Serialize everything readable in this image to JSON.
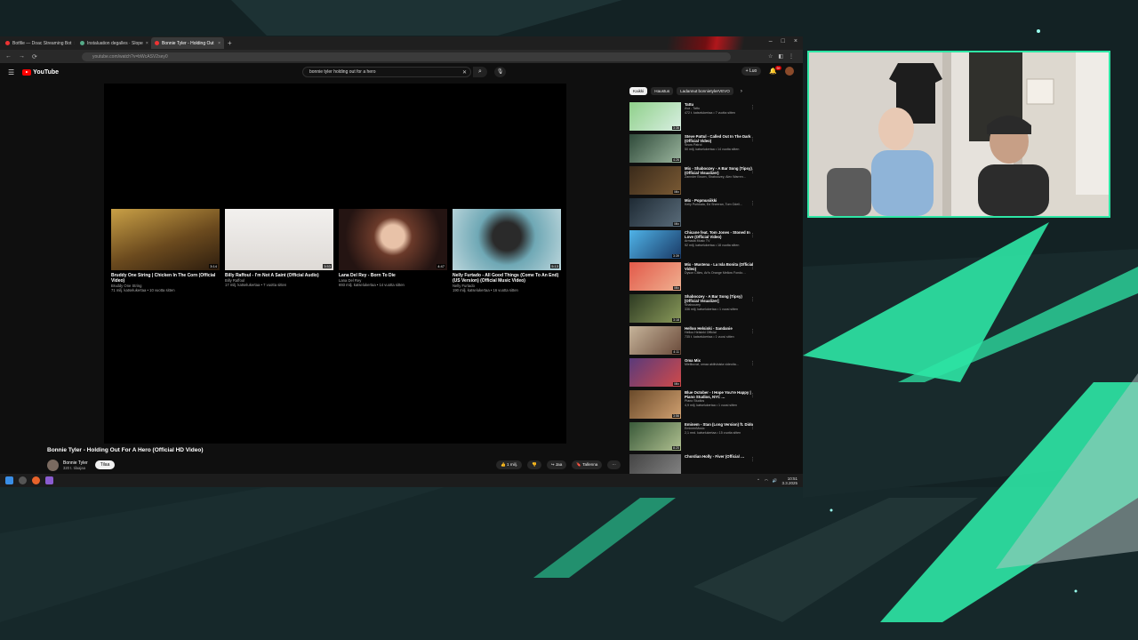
{
  "colors": {
    "accent_green": "#2ee6a5",
    "youtube_red": "#ff0000",
    "background": "#0f1a1c"
  },
  "browser": {
    "tabs": [
      {
        "label": "Botfile — Doac Streaming Bot",
        "active": false
      },
      {
        "label": "Instaluation degalles · Slope",
        "active": false
      },
      {
        "label": "Bonnie Tyler - Holding Out",
        "active": true
      }
    ],
    "url": "youtube.com/watch?v=bWcASV2sey0"
  },
  "youtube": {
    "logo_text": "YouTube",
    "search_value": "bonnie tyler holding out for a hero",
    "create_label": "Luo",
    "notification_count": "9+",
    "video_title": "Bonnie Tyler - Holding Out For A Hero (Official HD Video)",
    "channel_name": "Bonnie Tyler",
    "channel_subs": "320 t. tilaajaa",
    "subscribe_label": "Tilaa",
    "like_count": "1 milj.",
    "share_label": "Jaa",
    "save_label": "Tallenna",
    "endscreen": [
      {
        "title": "Bruddy One String | Chicken In The Corn (Official Video)",
        "channel": "Bruddy One String",
        "meta": "71 milj. katselukertaa • 10 vuotta sitten",
        "duration": "3:14"
      },
      {
        "title": "Billy Raffoul - I'm Not A Saint (Official Audio)",
        "channel": "Billy Raffoul",
        "meta": "17 milj. katselukertaa • 7 vuotta sitten",
        "duration": "3:53"
      },
      {
        "title": "Lana Del Rey - Born To Die",
        "channel": "Lana Del Rey",
        "meta": "693 milj. katselukertaa • 14 vuotta sitten",
        "duration": "4:47"
      },
      {
        "title": "Nelly Furtado - All Good Things (Come To An End) (US Version) (Official Music Video)",
        "channel": "Nelly Furtado",
        "meta": "190 milj. katselukertaa • 16 vuotta sitten",
        "duration": "5:13"
      }
    ],
    "chips": [
      "Kaikki",
      "Haustus",
      "Ladannut bonnietylerVEVO"
    ],
    "recommendations": [
      {
        "title": "Tattu",
        "channel": "Ava - Tattu",
        "meta": "472 t. katselukertaa • 7 vuotta sitten",
        "duration": "3:36"
      },
      {
        "title": "Steve Pattul - Called Out In The Dark (Official Video)",
        "channel": "Snow Patrol",
        "meta": "50 milj. katselukertaa • 14 vuotta sitten",
        "duration": "4:26"
      },
      {
        "title": "Mix - Shaboozey - A Bar Song (Tipsy) (Official Visualizer)",
        "channel": "Zannder Brown, Shaboozey, Alex Warren…",
        "meta": "",
        "duration": "Mix"
      },
      {
        "title": "Mix - Popmusiikki",
        "channel": "Kelly Purkkala, Ed Sheeran, Tom Odell…",
        "meta": "",
        "duration": "Mix"
      },
      {
        "title": "Chicane feat. Tom Jones - Stoned In Love (Official Video)",
        "channel": "Armada Music TV",
        "meta": "52 milj. katselukertaa • 18 vuotta sitten",
        "duration": "3:39"
      },
      {
        "title": "Mix - Mustena - La Isla Bonita (Official Video)",
        "channel": "Dyson Cities, Ari's Orange Mellow Fondo…",
        "meta": "",
        "duration": "Mix"
      },
      {
        "title": "Shaboozey - A Bar Song (Tipsy) [Official Visualizer]",
        "channel": "Shaboozey",
        "meta": "336 milj. katselukertaa • 1 vuosi sitten",
        "duration": "3:18"
      },
      {
        "title": "Helloo Helsinki - Sandanie",
        "channel": "Helloo Helsinki Official",
        "meta": "735 t. katselukertaa • 1 vuosi sitten",
        "duration": "4:11"
      },
      {
        "title": "Oma Mix",
        "channel": "Mielikuvat, omaa aktiivisista videoita…",
        "meta": "",
        "duration": "Mix"
      },
      {
        "title": "Blue October - I Hope You're Happy | Piano Studios, NYC …",
        "channel": "Piano Studios",
        "meta": "4,9 milj. katselukertaa • 1 vuosi sitten",
        "duration": "3:56"
      },
      {
        "title": "Eminem - Stan (Long Version) ft. Dido",
        "channel": "EminemMusic",
        "meta": "2,1 mrd. katselukertaa • 15 vuotta sitten",
        "duration": "8:20"
      },
      {
        "title": "Chordian Holly - Fiver (Official …",
        "channel": "",
        "meta": "",
        "duration": ""
      }
    ]
  },
  "taskbar": {
    "time": "10:51",
    "date": "3.3.2025"
  }
}
